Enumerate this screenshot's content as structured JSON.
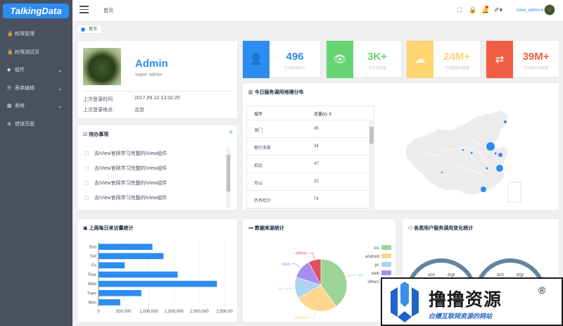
{
  "app": {
    "logo": "TalkingData"
  },
  "sidebar": {
    "items": [
      {
        "label": "权限管理",
        "icon": "lock-icon",
        "glyph": "🔒",
        "has_children": false
      },
      {
        "label": "权限测试页",
        "icon": "lock-icon",
        "glyph": "🔓",
        "has_children": false
      },
      {
        "label": "组件",
        "icon": "layers-icon",
        "glyph": "◆",
        "has_children": true
      },
      {
        "label": "表单编辑",
        "icon": "form-icon",
        "glyph": "☰",
        "has_children": true
      },
      {
        "label": "表格",
        "icon": "grid-icon",
        "glyph": "▦",
        "has_children": true
      },
      {
        "label": "错误页面",
        "icon": "error-icon",
        "glyph": "⊗",
        "has_children": false
      }
    ],
    "chevron": "⌵"
  },
  "header": {
    "breadcrumb": "首页",
    "user_name": "iview_admin ▾",
    "icons": [
      {
        "name": "fullscreen-icon",
        "glyph": "⛶"
      },
      {
        "name": "lock-screen-icon",
        "glyph": "🔒"
      },
      {
        "name": "bell-icon",
        "glyph": "🔔"
      },
      {
        "name": "theme-icon",
        "glyph": "✐"
      }
    ]
  },
  "tags": {
    "home": "首页"
  },
  "profile": {
    "name": "Admin",
    "role": "super admin",
    "last_login_time_label": "上次登录时间:",
    "last_login_time": "2017.09.12-13:32:20",
    "last_login_place_label": "上次登录地点:",
    "last_login_place": "北京"
  },
  "todo": {
    "title": "待办事项",
    "add": "+",
    "items": [
      "去iView官网学习完整的iView组件",
      "去iView官网学习完整的iView组件",
      "去iView官网学习完整的iView组件",
      "去iView官网学习完整的iView组件"
    ]
  },
  "stats": [
    {
      "value": "496",
      "label": "今日新增用户",
      "color": "#2d8cf0",
      "glyph": "👤",
      "icon": "add-user-icon"
    },
    {
      "value": "3K+",
      "label": "今日浏览量",
      "color": "#64d572",
      "glyph": "👁",
      "icon": "eye-icon"
    },
    {
      "value": "24M+",
      "label": "今日数据采集量",
      "color": "#ffd572",
      "glyph": "☁",
      "icon": "cloud-upload-icon"
    },
    {
      "value": "39M+",
      "label": "今日服务调用量",
      "color": "#f25e43",
      "glyph": "⇄",
      "icon": "shuffle-icon"
    }
  ],
  "map_card": {
    "title": "今日服务调用地理分布",
    "col_city": "城市",
    "col_flow": "流量(k)",
    "rows": [
      {
        "city": "海门",
        "flow": "45"
      },
      {
        "city": "鄂尔多斯",
        "flow": "34"
      },
      {
        "city": "招远",
        "flow": "47"
      },
      {
        "city": "舟山",
        "flow": "22"
      },
      {
        "city": "齐齐哈尔",
        "flow": "74"
      }
    ]
  },
  "weekly": {
    "title": "上周每日来访量统计",
    "chart_data": {
      "type": "bar",
      "orientation": "horizontal",
      "categories": [
        "Mon",
        "Tues",
        "Wed",
        "Thur",
        "Fri",
        "Sat",
        "Sun"
      ],
      "values": [
        430000,
        850000,
        2350000,
        1570000,
        520000,
        1290000,
        1070000
      ],
      "xticks": [
        "0",
        "500,000",
        "1,000,000",
        "1,500,000",
        "2,000,000",
        "2,500,00"
      ],
      "xlim": [
        0,
        2500000
      ],
      "grid": true,
      "color": "#2d8cf0"
    }
  },
  "source": {
    "title": "数据来源统计",
    "chart_data": {
      "type": "pie",
      "categories": [
        "ios",
        "android",
        "pc",
        "web",
        "others"
      ],
      "values": [
        36,
        24,
        12,
        11,
        7
      ],
      "colors": [
        "#9bd598",
        "#ffd58f",
        "#abd5f2",
        "#ab8df2",
        "#e14f60"
      ],
      "legend": "right"
    }
  },
  "service": {
    "title": "各类用户服务调用变化统计",
    "chart_data": {
      "type": "gauge",
      "gauges": [
        {
          "ticks": [
            "200",
            "400",
            "600",
            "700",
            "800"
          ]
        },
        {
          "ticks": [
            "200",
            "400",
            "600",
            "700",
            "800"
          ]
        }
      ]
    }
  },
  "watermark": {
    "title": "撸撸资源",
    "reg": "®",
    "subtitle": "白嫖互联网资源的网站"
  }
}
